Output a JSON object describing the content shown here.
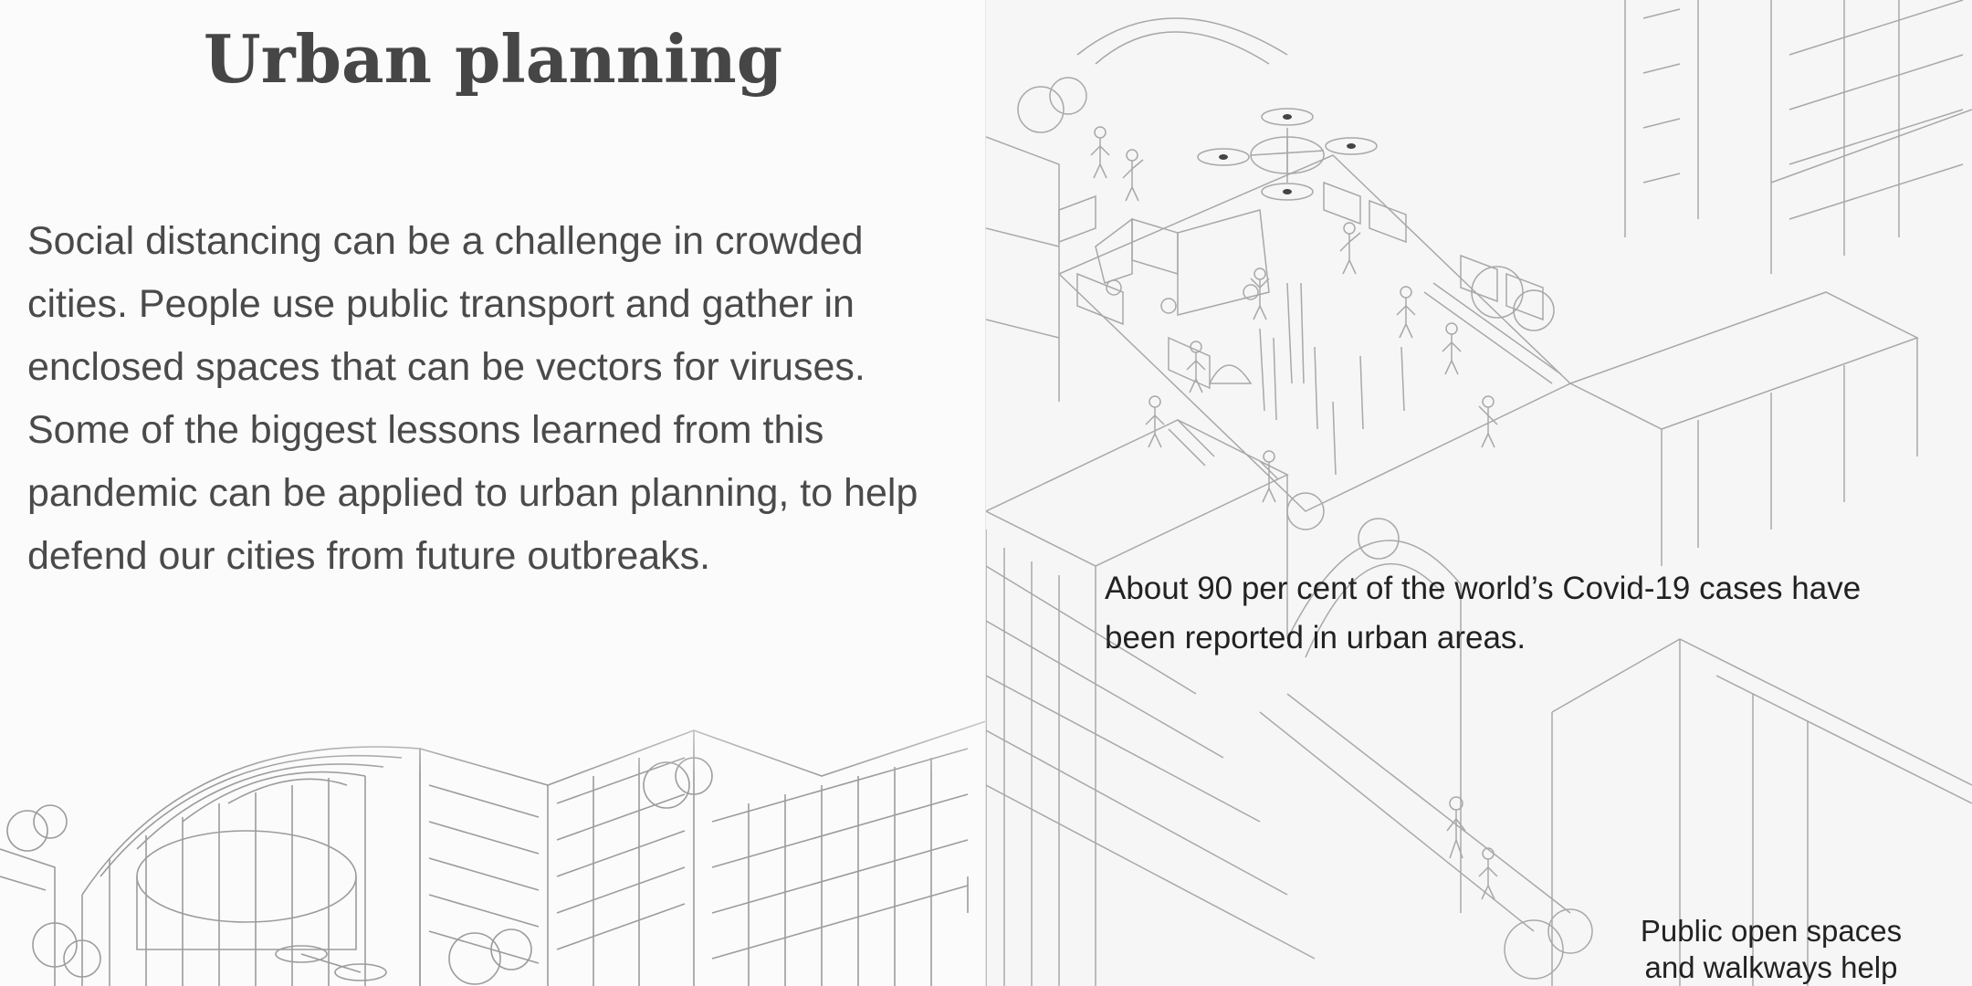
{
  "left": {
    "title": "Urban planning",
    "intro": "Social distancing can be a challenge in crowded cities. People use public transport and gather in enclosed spaces that can be vectors for viruses. Some of the biggest lessons learned from this pandemic can be applied to urban planning, to help defend our cities from future outbreaks.",
    "illustration": {
      "description_icon": "city-buildings-illustration"
    }
  },
  "right": {
    "fact": "About 90 per cent of the world’s Covid-19 cases have been reported in urban areas.",
    "caption": "Public open spaces\nand walkways help",
    "illustration": {
      "description_icon": "construction-site-illustration"
    }
  },
  "colors": {
    "title": "#464646",
    "body": "#4a4a4a",
    "fact": "#222222",
    "sketch": "#9a9a9a"
  }
}
